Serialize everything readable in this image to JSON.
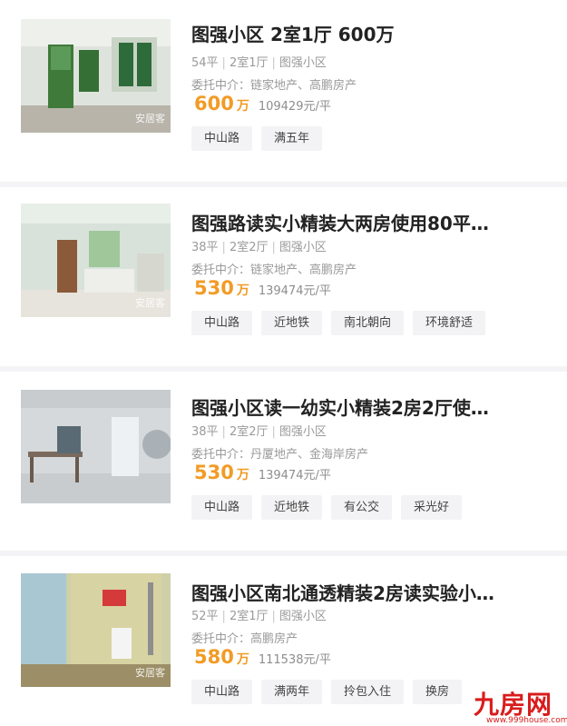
{
  "listings": [
    {
      "title": "图强小区 2室1厅 600万",
      "area": "54平",
      "layout": "2室1厅",
      "community": "图强小区",
      "agent": "委托中介：链家地产、高鹏房产",
      "price": "600",
      "price_unit": "万",
      "unit_price": "109429元/平",
      "tags": [
        "中山路",
        "满五年"
      ],
      "watermark": "安居客"
    },
    {
      "title": "图强路读实小精装大两房使用80平…",
      "area": "38平",
      "layout": "2室2厅",
      "community": "图强小区",
      "agent": "委托中介：链家地产、高鹏房产",
      "price": "530",
      "price_unit": "万",
      "unit_price": "139474元/平",
      "tags": [
        "中山路",
        "近地铁",
        "南北朝向",
        "环境舒适"
      ],
      "watermark": "安居客"
    },
    {
      "title": "图强小区读一幼实小精装2房2厅使…",
      "area": "38平",
      "layout": "2室2厅",
      "community": "图强小区",
      "agent": "委托中介：丹厦地产、金海岸房产",
      "price": "530",
      "price_unit": "万",
      "unit_price": "139474元/平",
      "tags": [
        "中山路",
        "近地铁",
        "有公交",
        "采光好"
      ],
      "watermark": ""
    },
    {
      "title": "图强小区南北通透精装2房读实验小…",
      "area": "52平",
      "layout": "2室1厅",
      "community": "图强小区",
      "agent": "委托中介：高鹏房产",
      "price": "580",
      "price_unit": "万",
      "unit_price": "111538元/平",
      "tags": [
        "中山路",
        "满两年",
        "拎包入住",
        "换房"
      ],
      "watermark": "安居客"
    }
  ],
  "site_logo": {
    "name": "九房网",
    "url": "www.999house.com"
  },
  "colors": {
    "price": "#f29b24",
    "tag_bg": "#f3f3f5",
    "divider": "#f4f4f6",
    "logo": "#d91c1c"
  }
}
